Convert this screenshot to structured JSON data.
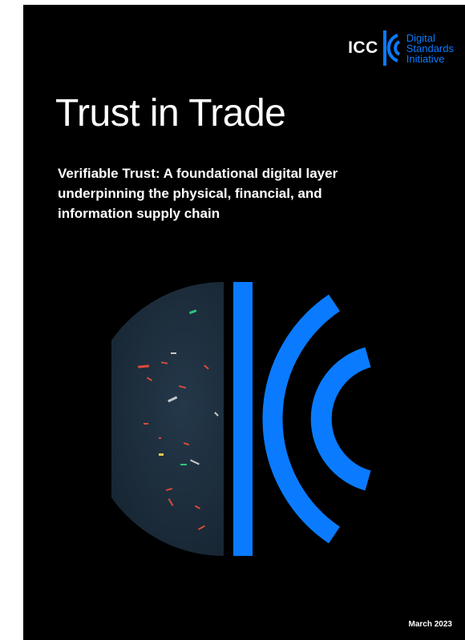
{
  "cover": {
    "title": "Trust in Trade",
    "subtitle": "Verifiable Trust: A foundational digital layer underpinning the physical, financial, and information supply chain",
    "date": "March 2023"
  },
  "logo": {
    "org": "ICC",
    "lines": [
      "Digital",
      "Standards",
      "Initiative"
    ]
  },
  "colors": {
    "background": "#000000",
    "brand_blue": "#0a7bff",
    "text": "#ffffff",
    "sea": "#1a2a38"
  },
  "icons": {
    "logo_mark": "icc-dsi-bracket-icon",
    "artwork": "ocean-semicircle-with-brackets-icon"
  }
}
